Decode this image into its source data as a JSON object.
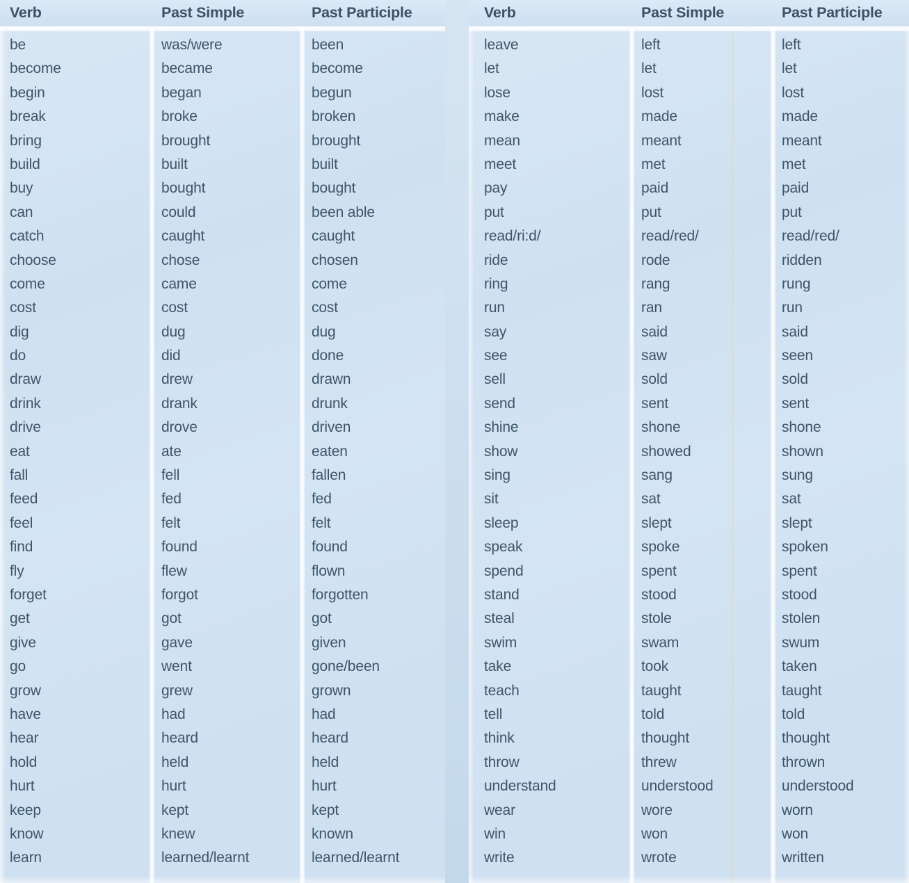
{
  "tables": [
    {
      "id": "left",
      "headers": [
        "Verb",
        "Past Simple",
        "Past Participle"
      ],
      "rows": [
        [
          "be",
          "was/were",
          "been"
        ],
        [
          "become",
          "became",
          "become"
        ],
        [
          "begin",
          "began",
          "begun"
        ],
        [
          "break",
          "broke",
          "broken"
        ],
        [
          "bring",
          "brought",
          "brought"
        ],
        [
          "build",
          "built",
          "built"
        ],
        [
          "buy",
          "bought",
          "bought"
        ],
        [
          "can",
          "could",
          "been able"
        ],
        [
          "catch",
          "caught",
          "caught"
        ],
        [
          "choose",
          "chose",
          "chosen"
        ],
        [
          "come",
          "came",
          "come"
        ],
        [
          "cost",
          "cost",
          "cost"
        ],
        [
          "dig",
          "dug",
          "dug"
        ],
        [
          "do",
          "did",
          "done"
        ],
        [
          "draw",
          "drew",
          "drawn"
        ],
        [
          "drink",
          "drank",
          "drunk"
        ],
        [
          "drive",
          "drove",
          "driven"
        ],
        [
          "eat",
          "ate",
          "eaten"
        ],
        [
          "fall",
          "fell",
          "fallen"
        ],
        [
          "feed",
          "fed",
          "fed"
        ],
        [
          "feel",
          "felt",
          "felt"
        ],
        [
          "find",
          "found",
          "found"
        ],
        [
          "fly",
          "flew",
          "flown"
        ],
        [
          "forget",
          "forgot",
          "forgotten"
        ],
        [
          "get",
          "got",
          "got"
        ],
        [
          "give",
          "gave",
          "given"
        ],
        [
          "go",
          "went",
          "gone/been"
        ],
        [
          "grow",
          "grew",
          "grown"
        ],
        [
          "have",
          "had",
          "had"
        ],
        [
          "hear",
          "heard",
          "heard"
        ],
        [
          "hold",
          "held",
          "held"
        ],
        [
          "hurt",
          "hurt",
          "hurt"
        ],
        [
          "keep",
          "kept",
          "kept"
        ],
        [
          "know",
          "knew",
          "known"
        ],
        [
          "learn",
          "learned/learnt",
          "learned/learnt"
        ]
      ]
    },
    {
      "id": "right",
      "headers": [
        "Verb",
        "Past Simple",
        "Past Participle"
      ],
      "rows": [
        [
          "leave",
          "left",
          "left"
        ],
        [
          "let",
          "let",
          "let"
        ],
        [
          "lose",
          "lost",
          "lost"
        ],
        [
          "make",
          "made",
          "made"
        ],
        [
          "mean",
          "meant",
          "meant"
        ],
        [
          "meet",
          "met",
          "met"
        ],
        [
          "pay",
          "paid",
          "paid"
        ],
        [
          "put",
          "put",
          "put"
        ],
        [
          "read/ri:d/",
          "read/red/",
          "read/red/"
        ],
        [
          "ride",
          "rode",
          "ridden"
        ],
        [
          "ring",
          "rang",
          "rung"
        ],
        [
          "run",
          "ran",
          "run"
        ],
        [
          "say",
          "said",
          "said"
        ],
        [
          "see",
          "saw",
          "seen"
        ],
        [
          "sell",
          "sold",
          "sold"
        ],
        [
          "send",
          "sent",
          "sent"
        ],
        [
          "shine",
          "shone",
          "shone"
        ],
        [
          "show",
          "showed",
          "shown"
        ],
        [
          "sing",
          "sang",
          "sung"
        ],
        [
          "sit",
          "sat",
          "sat"
        ],
        [
          "sleep",
          "slept",
          "slept"
        ],
        [
          "speak",
          "spoke",
          "spoken"
        ],
        [
          "spend",
          "spent",
          "spent"
        ],
        [
          "stand",
          "stood",
          "stood"
        ],
        [
          "steal",
          "stole",
          "stolen"
        ],
        [
          "swim",
          "swam",
          "swum"
        ],
        [
          "take",
          "took",
          "taken"
        ],
        [
          "teach",
          "taught",
          "taught"
        ],
        [
          "tell",
          "told",
          "told"
        ],
        [
          "think",
          "thought",
          "thought"
        ],
        [
          "throw",
          "threw",
          "thrown"
        ],
        [
          "understand",
          "understood",
          "understood"
        ],
        [
          "wear",
          "wore",
          "worn"
        ],
        [
          "win",
          "won",
          "won"
        ],
        [
          "write",
          "wrote",
          "written"
        ]
      ]
    }
  ],
  "colors": {
    "background": "#cfe1f1",
    "header_band": "#d7e6f5",
    "text": "#3e5569",
    "header_text": "#3c5266",
    "divider": "#ffffff"
  }
}
